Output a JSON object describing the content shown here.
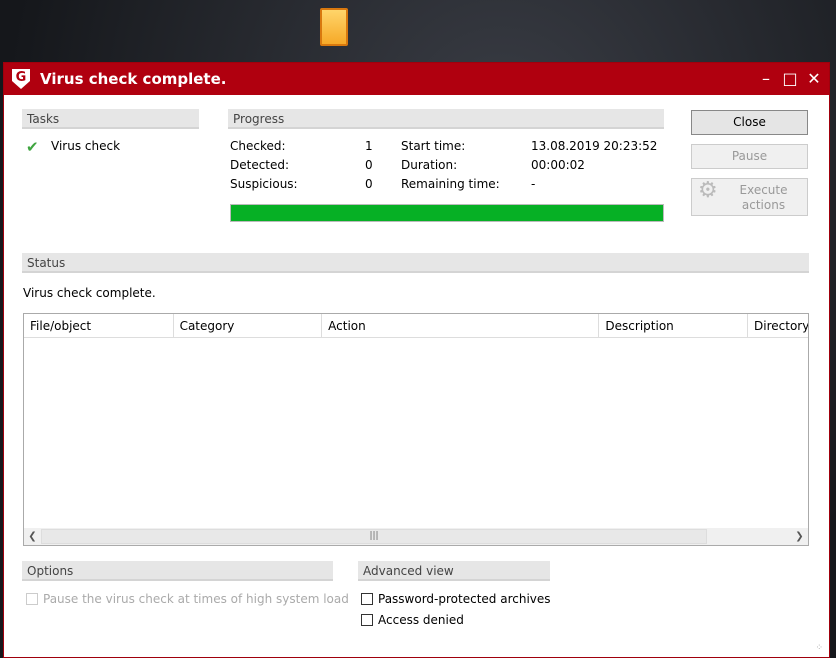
{
  "window": {
    "title": "Virus check complete.",
    "logo": "G",
    "controls": [
      "minimize",
      "maximize",
      "close"
    ]
  },
  "tasks": {
    "header": "Tasks",
    "item": "Virus check"
  },
  "progress": {
    "header": "Progress",
    "checked_label": "Checked:",
    "checked": "1",
    "detected_label": "Detected:",
    "detected": "0",
    "suspicious_label": "Suspicious:",
    "suspicious": "0",
    "start_label": "Start time:",
    "start": "13.08.2019 20:23:52",
    "duration_label": "Duration:",
    "duration": "00:00:02",
    "remaining_label": "Remaining time:",
    "remaining": "-",
    "percent": 100,
    "color": "#06b025"
  },
  "buttons": {
    "close": "Close",
    "pause": "Pause",
    "execute": "Execute actions"
  },
  "status": {
    "header": "Status",
    "text": "Virus check complete."
  },
  "table": {
    "columns": [
      "File/object",
      "Category",
      "Action",
      "Description",
      "Directory"
    ],
    "rows": []
  },
  "options": {
    "header": "Options",
    "pause_load": "Pause the virus check at times of high system load"
  },
  "advanced": {
    "header": "Advanced view",
    "password": "Password-protected archives",
    "access": "Access denied"
  }
}
